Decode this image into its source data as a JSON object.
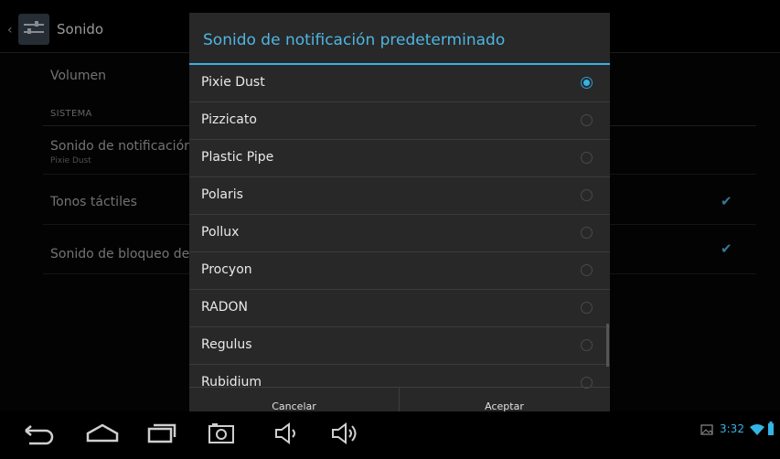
{
  "action_bar": {
    "title": "Sonido"
  },
  "settings": {
    "volume_label": "Volumen",
    "category_label": "SISTEMA",
    "notification_sound_title": "Sonido de notificación",
    "notification_sound_summary": "Pixie Dust",
    "touch_sounds_label": "Tonos táctiles",
    "screen_lock_label": "Sonido de bloqueo de p"
  },
  "dialog": {
    "title": "Sonido de notificación predeterminado",
    "options": [
      {
        "label": "Pixie Dust",
        "selected": true
      },
      {
        "label": "Pizzicato",
        "selected": false
      },
      {
        "label": "Plastic Pipe",
        "selected": false
      },
      {
        "label": "Polaris",
        "selected": false
      },
      {
        "label": "Pollux",
        "selected": false
      },
      {
        "label": "Procyon",
        "selected": false
      },
      {
        "label": "RADON",
        "selected": false
      },
      {
        "label": "Regulus",
        "selected": false
      },
      {
        "label": "Rubidium",
        "selected": false
      }
    ],
    "cancel_label": "Cancelar",
    "accept_label": "Aceptar"
  },
  "status_bar": {
    "time": "3:32"
  },
  "colors": {
    "accent": "#33b5e5"
  }
}
